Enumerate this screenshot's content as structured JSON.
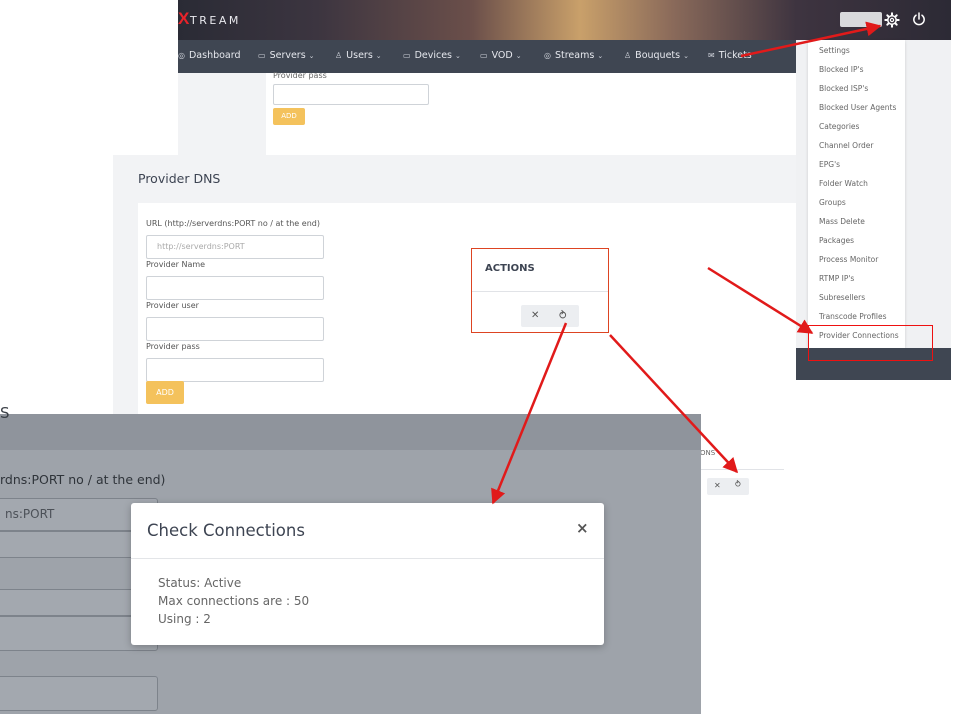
{
  "app": {
    "logo_x": "X",
    "logo_text": "TREAM"
  },
  "nav": [
    {
      "label": "Dashboard",
      "icon": "dashboard-icon",
      "glyph": "◎",
      "dropdown": false
    },
    {
      "label": "Servers",
      "icon": "server-icon",
      "glyph": "▭",
      "dropdown": true
    },
    {
      "label": "Users",
      "icon": "user-icon",
      "glyph": "♙",
      "dropdown": true
    },
    {
      "label": "Devices",
      "icon": "device-icon",
      "glyph": "▭",
      "dropdown": true
    },
    {
      "label": "VOD",
      "icon": "video-icon",
      "glyph": "▭",
      "dropdown": true
    },
    {
      "label": "Streams",
      "icon": "stream-icon",
      "glyph": "◎",
      "dropdown": true
    },
    {
      "label": "Bouquets",
      "icon": "bouquet-icon",
      "glyph": "♙",
      "dropdown": true
    },
    {
      "label": "Tickets",
      "icon": "ticket-icon",
      "glyph": "✉",
      "dropdown": false
    }
  ],
  "top_form": {
    "label": "Provider pass",
    "add": "ADD"
  },
  "settings_menu": [
    "Settings",
    "Blocked IP's",
    "Blocked ISP's",
    "Blocked User Agents",
    "Categories",
    "Channel Order",
    "EPG's",
    "Folder Watch",
    "Groups",
    "Mass Delete",
    "Packages",
    "Process Monitor",
    "RTMP IP's",
    "Subresellers",
    "Transcode Profiles",
    "Provider Connections"
  ],
  "provider_dns": {
    "title": "Provider DNS",
    "url_label": "URL (http://serverdns:PORT no / at the end)",
    "url_placeholder": "http://serverdns:PORT",
    "name_label": "Provider Name",
    "user_label": "Provider user",
    "pass_label": "Provider pass",
    "add": "ADD"
  },
  "actions": {
    "title": "ACTIONS",
    "delete": "✕",
    "check": "⥁",
    "small_header": "ONS"
  },
  "overlay": {
    "title_fragment": "S",
    "url_label_fragment": "rdns:PORT no / at the end)",
    "url_placeholder_fragment": "ns:PORT"
  },
  "modal": {
    "title": "Check Connections",
    "close": "×",
    "status": "Status: Active",
    "max": "Max connections are : 50",
    "using": "Using : 2"
  },
  "colors": {
    "accent_add": "#f4c25c",
    "arrow": "#e11a1a",
    "nav_bg": "#3f4652"
  }
}
